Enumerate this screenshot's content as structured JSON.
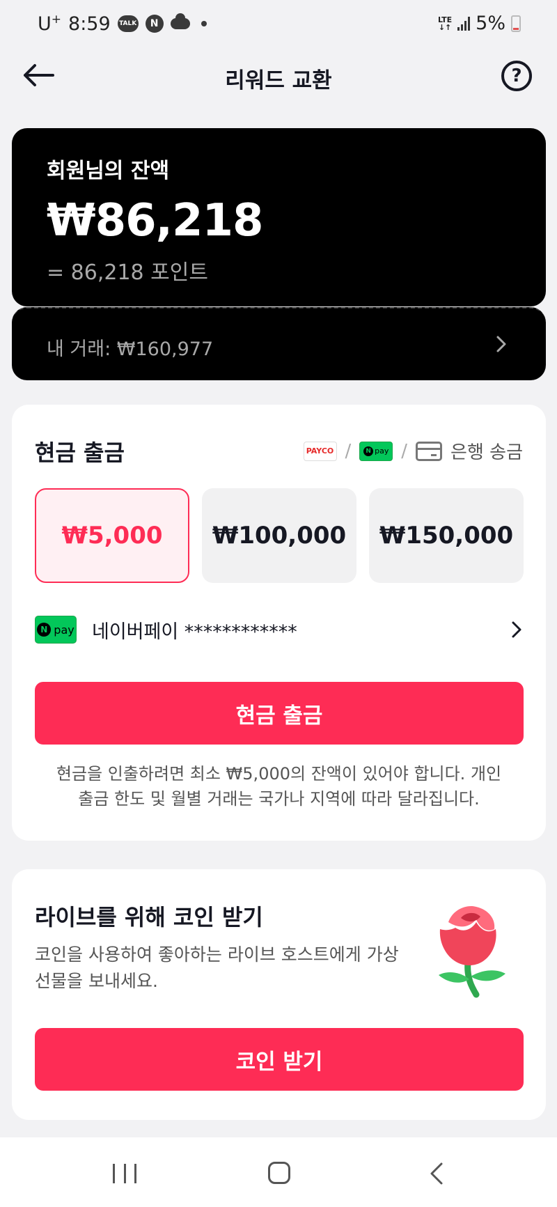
{
  "status_bar": {
    "carrier": "U",
    "carrier_plus": "+",
    "time": "8:59",
    "talk": "TALK",
    "n": "N",
    "lte": "LTE",
    "battery": "5%"
  },
  "header": {
    "title": "리워드 교환",
    "help": "?"
  },
  "balance": {
    "label": "회원님의 잔액",
    "amount": "₩86,218",
    "points": "= 86,218 포인트",
    "trade_label": "내 거래: ₩160,977"
  },
  "cash_withdraw": {
    "title": "현금 출금",
    "methods": {
      "payco": "PAYCO",
      "npay_n": "N",
      "npay_text": "pay",
      "separator": "/",
      "bank": "은행 송금"
    },
    "amounts": [
      {
        "label": "₩5,000",
        "selected": true
      },
      {
        "label": "₩100,000",
        "selected": false
      },
      {
        "label": "₩150,000",
        "selected": false
      }
    ],
    "payment_method": "네이버페이 ************",
    "button": "현금 출금",
    "notice": "현금을 인출하려면 최소 ₩5,000의 잔액이 있어야 합니다. 개인 출금 한도 및 월별 거래는 국가나 지역에 따라 달라집니다."
  },
  "coins": {
    "title": "라이브를 위해 코인 받기",
    "description": "코인을 사용하여 좋아하는 라이브 호스트에게 가상 선물을 보내세요.",
    "button": "코인 받기"
  },
  "colors": {
    "accent": "#fe2c55",
    "npay_green": "#03c75a",
    "background": "#f2f2f4"
  }
}
